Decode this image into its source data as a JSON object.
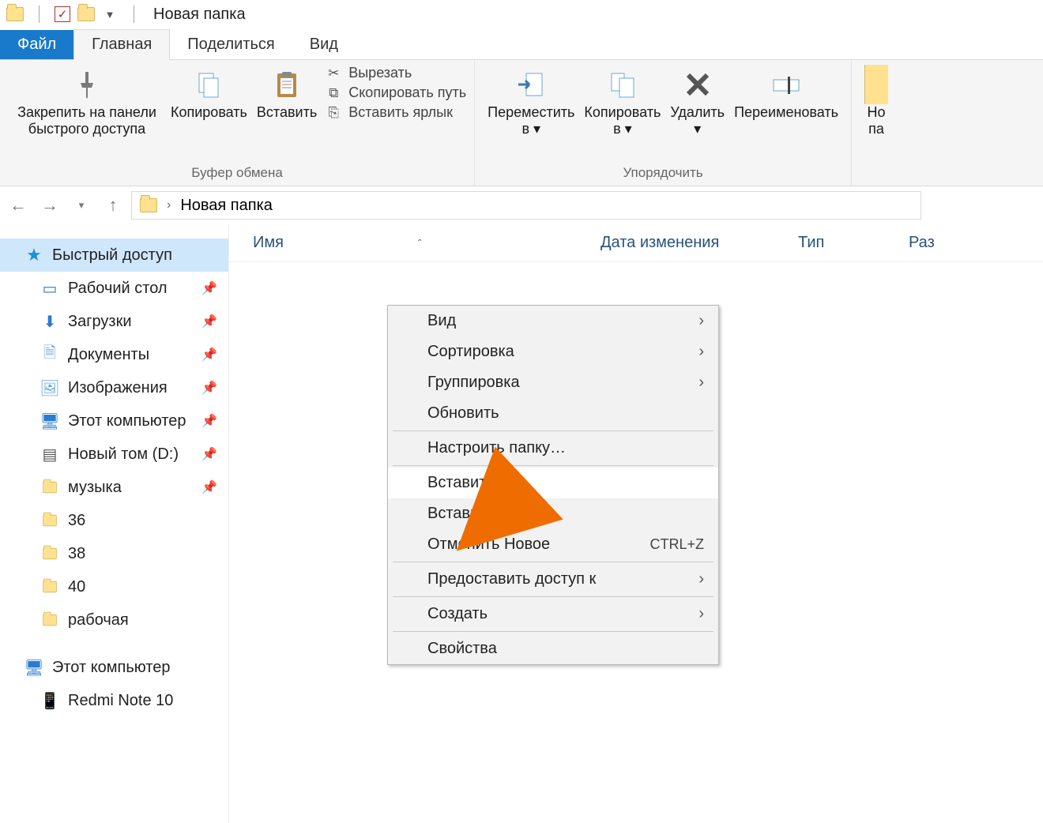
{
  "titlebar": {
    "window_title": "Новая папка"
  },
  "tabs": {
    "file": "Файл",
    "home": "Главная",
    "share": "Поделиться",
    "view": "Вид"
  },
  "ribbon": {
    "clipboard": {
      "pin": "Закрепить на панели\nбыстрого доступа",
      "copy": "Копировать",
      "paste": "Вставить",
      "cut": "Вырезать",
      "copy_path": "Скопировать путь",
      "paste_shortcut": "Вставить ярлык",
      "group": "Буфер обмена"
    },
    "organize": {
      "move_to": "Переместить\nв ▾",
      "copy_to": "Копировать\nв ▾",
      "delete": "Удалить\n▾",
      "rename": "Переименовать",
      "group": "Упорядочить"
    },
    "new_partial": "Но\nпа"
  },
  "breadcrumb": {
    "folder": "Новая папка",
    "sep": "›"
  },
  "columns": {
    "name": "Имя",
    "date": "Дата изменения",
    "type": "Тип",
    "size": "Раз"
  },
  "sidebar": {
    "quick_access": "Быстрый доступ",
    "items": [
      {
        "label": "Рабочий стол",
        "icon": "desktop",
        "pinned": true
      },
      {
        "label": "Загрузки",
        "icon": "downloads",
        "pinned": true
      },
      {
        "label": "Документы",
        "icon": "documents",
        "pinned": true
      },
      {
        "label": "Изображения",
        "icon": "pictures",
        "pinned": true
      },
      {
        "label": "Этот компьютер",
        "icon": "pc",
        "pinned": true
      },
      {
        "label": "Новый том (D:)",
        "icon": "drive",
        "pinned": true
      },
      {
        "label": "музыка",
        "icon": "folder",
        "pinned": true
      },
      {
        "label": "36",
        "icon": "folder",
        "pinned": false
      },
      {
        "label": "38",
        "icon": "folder",
        "pinned": false
      },
      {
        "label": "40",
        "icon": "folder",
        "pinned": false
      },
      {
        "label": "рабочая",
        "icon": "folder",
        "pinned": false
      }
    ],
    "this_pc": "Этот компьютер",
    "device": "Redmi Note 10"
  },
  "context_menu": {
    "view": "Вид",
    "sort": "Сортировка",
    "group": "Группировка",
    "refresh": "Обновить",
    "customize": "Настроить папку…",
    "paste": "Вставить",
    "paste_shortcut": "Вставить ярлык",
    "undo": "Отменить Новое",
    "undo_shortcut": "CTRL+Z",
    "give_access": "Предоставить доступ к",
    "new": "Создать",
    "properties": "Свойства"
  }
}
